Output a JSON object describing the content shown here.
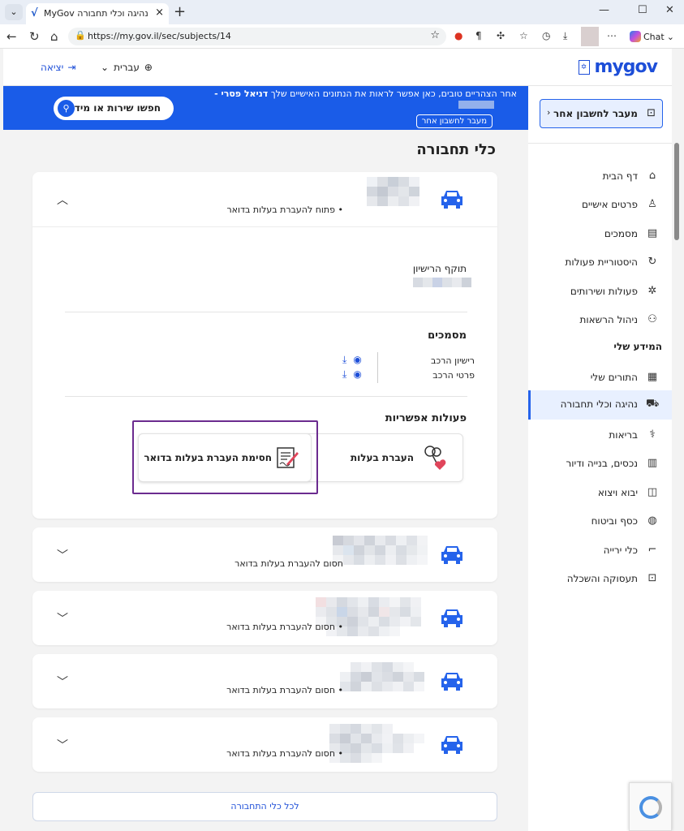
{
  "browser": {
    "tab_title": "MyGov נהיגה וכלי תחבורה",
    "url": "https://my.gov.il/sec/subjects/14",
    "chat_label": "Chat"
  },
  "header": {
    "logo_text": "mygov",
    "language": "עברית",
    "logout": "יציאה"
  },
  "banner": {
    "message": "אחר הצהריים טובים,  כאן אפשר לראות את הנתונים האישיים שלך",
    "user_name": "דניאל פסרי -",
    "switch_account_small": "מעבר לחשבון אחר",
    "search_label": "חפשו שירות או מידע"
  },
  "sidebar": {
    "switch_account": "מעבר לחשבון אחר",
    "items": [
      {
        "label": "דף הבית",
        "icon": "home-icon",
        "glyph": "⌂"
      },
      {
        "label": "פרטים אישיים",
        "icon": "person-icon",
        "glyph": "♙"
      },
      {
        "label": "מסמכים",
        "icon": "document-icon",
        "glyph": "▤"
      },
      {
        "label": "היסטוריית פעולות",
        "icon": "history-icon",
        "glyph": "↻"
      },
      {
        "label": "פעולות ושירותים",
        "icon": "sparkle-icon",
        "glyph": "✲"
      },
      {
        "label": "ניהול הרשאות",
        "icon": "users-icon",
        "glyph": "⚇"
      }
    ],
    "section_title": "המידע שלי",
    "info_items": [
      {
        "label": "התורים שלי",
        "icon": "calendar-icon",
        "glyph": "▦"
      },
      {
        "label": "נהיגה וכלי תחבורה",
        "icon": "car-icon",
        "glyph": "⛟"
      },
      {
        "label": "בריאות",
        "icon": "stethoscope-icon",
        "glyph": "⚕"
      },
      {
        "label": "נכסים, בנייה ודיור",
        "icon": "building-icon",
        "glyph": "▥"
      },
      {
        "label": "יבוא ויצוא",
        "icon": "bag-icon",
        "glyph": "◫"
      },
      {
        "label": "כסף וביטוח",
        "icon": "coins-icon",
        "glyph": "◍"
      },
      {
        "label": "כלי ירייה",
        "icon": "firearm-icon",
        "glyph": "⌐"
      },
      {
        "label": "תעסוקה והשכלה",
        "icon": "briefcase-icon",
        "glyph": "⊡"
      }
    ]
  },
  "main": {
    "title": "כלי תחבורה",
    "expanded_vehicle": {
      "status": "• פתוח להעברת בעלות בדואר",
      "license_validity_label": "תוקף הרישיון",
      "documents_title": "מסמכים",
      "documents": [
        {
          "label": "רישיון הרכב"
        },
        {
          "label": "פרטי הרכב"
        }
      ],
      "actions_title": "פעולות אפשריות",
      "actions": [
        {
          "label": "העברת בעלות"
        },
        {
          "label": "חסימת העברת בעלות בדואר"
        }
      ]
    },
    "vehicles": [
      {
        "status": "חסום להעברת בעלות בדואר"
      },
      {
        "status": "• חסום להעברת בעלות בדואר"
      },
      {
        "status": "• חסום להעברת בעלות בדואר"
      },
      {
        "status": "• חסום להעברת בעלות בדואר"
      }
    ],
    "all_vehicles_link": "לכל כלי התחבורה"
  },
  "colors": {
    "accent": "#1a5ce8",
    "highlight": "#6b2b8f",
    "car": "#2563eb"
  }
}
